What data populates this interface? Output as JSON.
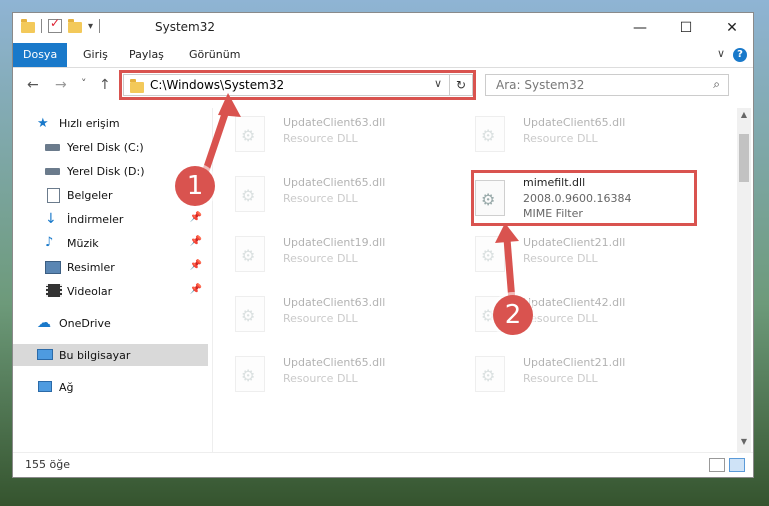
{
  "window": {
    "title": "System32",
    "controls": {
      "minimize": "—",
      "maximize": "☐",
      "close": "✕"
    }
  },
  "ribbon": {
    "tabs": [
      {
        "label": "Dosya",
        "active": true
      },
      {
        "label": "Giriş",
        "active": false
      },
      {
        "label": "Paylaş",
        "active": false
      },
      {
        "label": "Görünüm",
        "active": false
      }
    ],
    "help": "?"
  },
  "navigation": {
    "back": "←",
    "forward": "→",
    "recent": "˅",
    "up": "↑",
    "address": "C:\\Windows\\System32",
    "refresh": "↻",
    "search_placeholder": "Ara: System32"
  },
  "sidebar": {
    "items": [
      {
        "label": "Hızlı erişim",
        "icon": "star-icon",
        "pinned": false
      },
      {
        "label": "Yerel Disk (C:)",
        "icon": "drive-icon",
        "pinned": false
      },
      {
        "label": "Yerel Disk (D:)",
        "icon": "drive-icon",
        "pinned": false
      },
      {
        "label": "Belgeler",
        "icon": "documents-icon",
        "pinned": false
      },
      {
        "label": "İndirmeler",
        "icon": "download-icon",
        "pinned": true
      },
      {
        "label": "Müzik",
        "icon": "music-icon",
        "pinned": true
      },
      {
        "label": "Resimler",
        "icon": "pictures-icon",
        "pinned": true
      },
      {
        "label": "Videolar",
        "icon": "videos-icon",
        "pinned": true
      },
      {
        "label": "OneDrive",
        "icon": "cloud-icon",
        "pinned": false
      },
      {
        "label": "Bu bilgisayar",
        "icon": "computer-icon",
        "pinned": false,
        "selected": true
      },
      {
        "label": "Ağ",
        "icon": "network-icon",
        "pinned": false
      }
    ]
  },
  "files": [
    {
      "name": "UpdateClient63.dll",
      "type": "Resource DLL",
      "faded": true
    },
    {
      "name": "UpdateClient65.dll",
      "type": "Resource DLL",
      "faded": true
    },
    {
      "name": "UpdateClient65.dll",
      "type": "Resource DLL",
      "faded": true
    },
    {
      "name": "mimefilt.dll",
      "version": "2008.0.9600.16384",
      "type": "MIME Filter",
      "faded": false
    },
    {
      "name": "UpdateClient19.dll",
      "type": "Resource DLL",
      "faded": true
    },
    {
      "name": "UpdateClient21.dll",
      "type": "Resource DLL",
      "faded": true
    },
    {
      "name": "UpdateClient63.dll",
      "type": "Resource DLL",
      "faded": true
    },
    {
      "name": "UpdateClient42.dll",
      "type": "Resource DLL",
      "faded": true
    },
    {
      "name": "UpdateClient65.dll",
      "type": "Resource DLL",
      "faded": true
    },
    {
      "name": "UpdateClient21.dll",
      "type": "Resource DLL",
      "faded": true
    }
  ],
  "status": {
    "count": "155 öğe"
  },
  "callouts": [
    {
      "label": "1"
    },
    {
      "label": "2"
    }
  ],
  "colors": {
    "accent": "#1979ca",
    "highlight": "#d9534f",
    "selected": "#d9d9d9"
  }
}
